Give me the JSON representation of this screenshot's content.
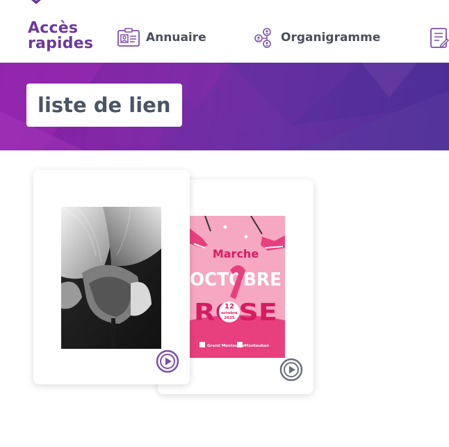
{
  "quick_access": {
    "title_line1": "Accès",
    "title_line2": "rapides",
    "items": [
      {
        "label": "Annuaire",
        "icon": "id-card-icon"
      },
      {
        "label": "Organigramme",
        "icon": "org-chart-icon"
      },
      {
        "label": "",
        "icon": "form-icon"
      }
    ]
  },
  "banner": {
    "label": "liste de lien"
  },
  "cards": [
    {
      "thumbnail": "white-flower-photo",
      "icon": "play-icon"
    },
    {
      "thumbnail": "marche-octobre-rose-poster",
      "icon": "play-icon",
      "poster": {
        "line1": "Marche",
        "line2": "OCTOBRE",
        "line3": "ROSE",
        "day": "12",
        "month": "octobre",
        "year": "2025",
        "logo_left": "Grand Montauban",
        "logo_right": "Montauban"
      }
    }
  ],
  "colors": {
    "brand_purple": "#6b3a9b",
    "icon_purple": "#7a4fa8",
    "text_gray": "#4a5563",
    "pink": "#e8407f"
  }
}
